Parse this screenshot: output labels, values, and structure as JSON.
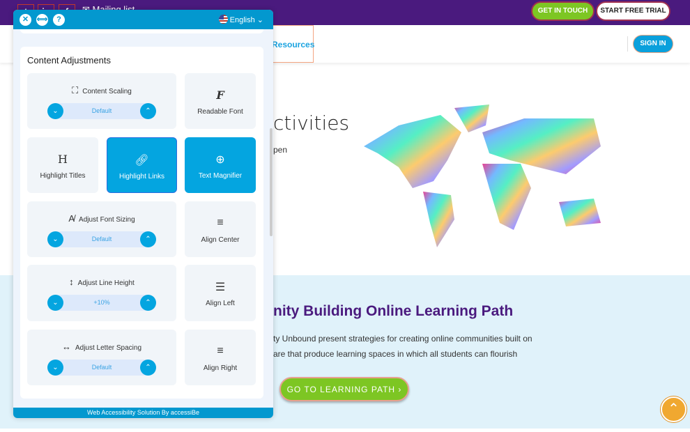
{
  "topbar": {
    "social": [
      "twitter-icon",
      "linkedin-icon",
      "facebook-icon"
    ],
    "social_glyphs": [
      "t",
      "in",
      "f"
    ],
    "mailing": "Mailing list",
    "get_in_touch": "GET IN TOUCH",
    "free_trial": "START FREE TRIAL"
  },
  "nav": {
    "resources": "Resources",
    "sign_in": "SIGN IN"
  },
  "hero": {
    "heading": "ctivities",
    "text": "pen"
  },
  "section": {
    "heading": "nity Building Online Learning Path",
    "line1": "ty Unbound present strategies for creating online communities built on",
    "line2": "are that produce learning spaces in which all students can flourish",
    "button": "GO TO LEARNING PATH ›"
  },
  "panel": {
    "language": "English",
    "close": "✕",
    "move": "⟺",
    "help": "?",
    "title": "Content Adjustments",
    "footer": "Web Accessibility Solution By accessiBe",
    "tiles": {
      "content_scaling": "Content Scaling",
      "content_scaling_value": "Default",
      "readable_font": "Readable Font",
      "highlight_titles": "Highlight Titles",
      "highlight_links": "Highlight Links",
      "text_magnifier": "Text Magnifier",
      "font_sizing": "Adjust Font Sizing",
      "font_sizing_value": "Default",
      "align_center": "Align Center",
      "line_height": "Adjust Line Height",
      "line_height_value": "+10%",
      "align_left": "Align Left",
      "letter_spacing": "Adjust Letter Spacing",
      "letter_spacing_value": "Default",
      "align_right": "Align Right"
    },
    "active": [
      "Highlight Links",
      "Text Magnifier"
    ]
  },
  "colors": {
    "purple": "#4a1a7e",
    "accent": "#04a5e0",
    "green": "#7dc623"
  }
}
